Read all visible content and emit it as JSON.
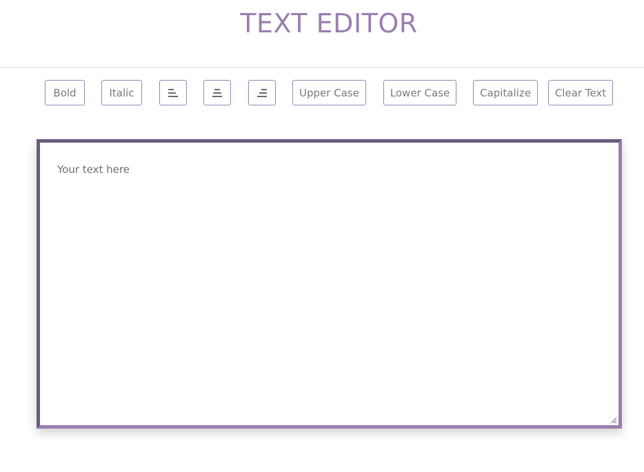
{
  "app": {
    "title": "TEXT EDITOR"
  },
  "toolbar": {
    "bold": "Bold",
    "italic": "Italic",
    "align_left_icon": "align-left-icon",
    "align_center_icon": "align-center-icon",
    "align_right_icon": "align-right-icon",
    "upper_case": "Upper Case",
    "lower_case": "Lower Case",
    "capitalize": "Capitalize",
    "clear_text": "Clear Text"
  },
  "editor": {
    "placeholder": "Your text here",
    "value": ""
  },
  "colors": {
    "accent": "#9a7eb0",
    "accent_dark": "#6b5b7e",
    "button_border": "#9b85b8",
    "text": "#7a7a7a"
  }
}
